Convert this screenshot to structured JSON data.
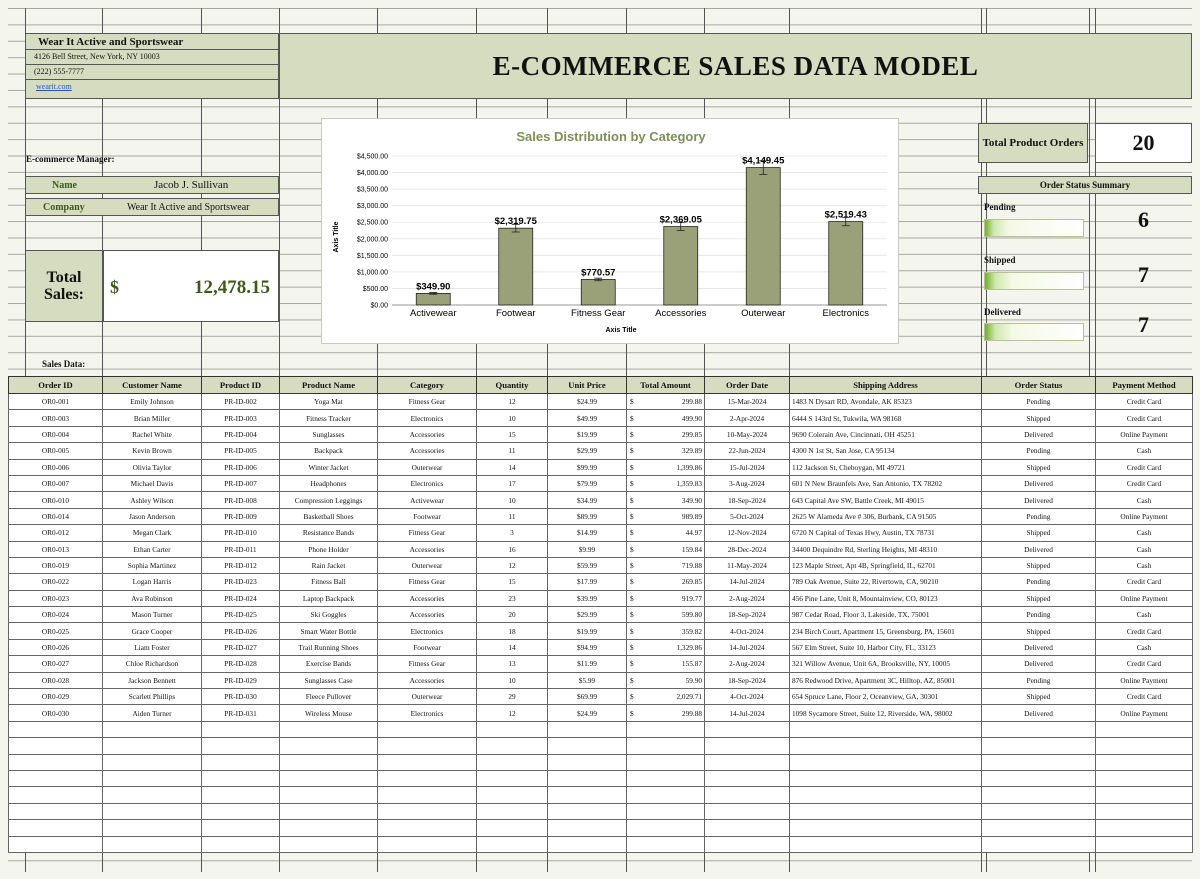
{
  "company": {
    "name": "Wear It Active and Sportswear",
    "address": "4126 Bell Street, New York, NY 10003",
    "phone": "(222) 555-7777",
    "website": "wearit.com"
  },
  "page_title": "E-COMMERCE SALES DATA MODEL",
  "manager": {
    "section_label": "E-commerce Manager:",
    "name_label": "Name",
    "name_value": "Jacob J. Sullivan",
    "company_label": "Company",
    "company_value": "Wear It Active and Sportswear"
  },
  "total_sales": {
    "label": "Total Sales:",
    "currency": "$",
    "value": "12,478.15"
  },
  "summary": {
    "total_orders_label": "Total Product Orders",
    "total_orders_value": "20",
    "status_title": "Order Status Summary",
    "statuses": [
      {
        "label": "Pending",
        "count": "6",
        "fill": 0.3
      },
      {
        "label": "Shipped",
        "count": "7",
        "fill": 0.35
      },
      {
        "label": "Delivered",
        "count": "7",
        "fill": 0.35
      }
    ]
  },
  "sales_data_label": "Sales Data:",
  "table": {
    "headers": [
      "Order ID",
      "Customer Name",
      "Product ID",
      "Product Name",
      "Category",
      "Quantity",
      "Unit Price",
      "Total Amount",
      "Order Date",
      "Shipping Address",
      "Order Status",
      "Payment Method"
    ],
    "rows": [
      [
        "OR0-001",
        "Emily Johnson",
        "PR-ID-002",
        "Yoga Mat",
        "Fitness Gear",
        "12",
        "$24.99",
        "299.88",
        "15-Mar-2024",
        "1483 N Dysart RD, Avondale, AK 85323",
        "Pending",
        "Credit Card"
      ],
      [
        "OR0-003",
        "Brian Miller",
        "PR-ID-003",
        "Fitness Tracker",
        "Electronics",
        "10",
        "$49.99",
        "499.90",
        "2-Apr-2024",
        "6444 S 143rd St, Tukwila, WA 98168",
        "Shipped",
        "Credit Card"
      ],
      [
        "OR0-004",
        "Rachel White",
        "PR-ID-004",
        "Sunglasses",
        "Accessories",
        "15",
        "$19.99",
        "299.85",
        "10-May-2024",
        "9690 Colerain Ave, Cincinnati, OH 45251",
        "Delivered",
        "Online Payment"
      ],
      [
        "OR0-005",
        "Kevin Brown",
        "PR-ID-005",
        "Backpack",
        "Accessories",
        "11",
        "$29.99",
        "329.89",
        "22-Jun-2024",
        "4300 N 1st St, San Jose, CA 95134",
        "Pending",
        "Cash"
      ],
      [
        "OR0-006",
        "Olivia Taylor",
        "PR-ID-006",
        "Winter Jacket",
        "Outerwear",
        "14",
        "$99.99",
        "1,399.86",
        "15-Jul-2024",
        "112 Jackson St, Cheboygan, MI 49721",
        "Shipped",
        "Credit Card"
      ],
      [
        "OR0-007",
        "Michael Davis",
        "PR-ID-007",
        "Headphones",
        "Electronics",
        "17",
        "$79.99",
        "1,359.83",
        "3-Aug-2024",
        "601 N New Braunfels Ave, San Antonio, TX 78202",
        "Delivered",
        "Credit Card"
      ],
      [
        "OR0-010",
        "Ashley Wilson",
        "PR-ID-008",
        "Compression Leggings",
        "Activewear",
        "10",
        "$34.99",
        "349.90",
        "18-Sep-2024",
        "643 Capital Ave SW, Battle Creek, MI 49015",
        "Delivered",
        "Cash"
      ],
      [
        "OR0-014",
        "Jason Anderson",
        "PR-ID-009",
        "Basketball Shoes",
        "Footwear",
        "11",
        "$89.99",
        "989.89",
        "5-Oct-2024",
        "2625 W Alameda Ave # 306, Burbank, CA 91505",
        "Pending",
        "Online Payment"
      ],
      [
        "OR0-012",
        "Megan Clark",
        "PR-ID-010",
        "Resistance Bands",
        "Fitness Gear",
        "3",
        "$14.99",
        "44.97",
        "12-Nov-2024",
        "6720 N Capital of Texas Hwy, Austin, TX 78731",
        "Shipped",
        "Cash"
      ],
      [
        "OR0-013",
        "Ethan Carter",
        "PR-ID-011",
        "Phone Holder",
        "Accessories",
        "16",
        "$9.99",
        "159.84",
        "28-Dec-2024",
        "34400 Dequindre Rd, Sterling Heights, MI 48310",
        "Delivered",
        "Cash"
      ],
      [
        "OR0-019",
        "Sophia Martinez",
        "PR-ID-012",
        "Rain Jacket",
        "Outerwear",
        "12",
        "$59.99",
        "719.88",
        "11-May-2024",
        "123 Maple Street, Apt 4B, Springfield, IL, 62701",
        "Shipped",
        "Cash"
      ],
      [
        "OR0-022",
        "Logan Harris",
        "PR-ID-023",
        "Fitness Ball",
        "Fitness Gear",
        "15",
        "$17.99",
        "269.85",
        "14-Jul-2024",
        "789 Oak Avenue, Suite 22, Rivertown, CA, 90210",
        "Pending",
        "Credit Card"
      ],
      [
        "OR0-023",
        "Ava Robinson",
        "PR-ID-024",
        "Laptop Backpack",
        "Accessories",
        "23",
        "$39.99",
        "919.77",
        "2-Aug-2024",
        "456 Pine Lane, Unit 8, Mountainview, CO, 80123",
        "Shipped",
        "Online Payment"
      ],
      [
        "OR0-024",
        "Mason Turner",
        "PR-ID-025",
        "Ski Goggles",
        "Accessories",
        "20",
        "$29.99",
        "599.80",
        "18-Sep-2024",
        "987 Cedar Road, Floor 3, Lakeside, TX, 75001",
        "Pending",
        "Cash"
      ],
      [
        "OR0-025",
        "Grace Cooper",
        "PR-ID-026",
        "Smart Water Bottle",
        "Electronics",
        "18",
        "$19.99",
        "359.82",
        "4-Oct-2024",
        "234 Birch Court, Apartment 15, Greensburg, PA, 15601",
        "Shipped",
        "Credit Card"
      ],
      [
        "OR0-026",
        "Liam Foster",
        "PR-ID-027",
        "Trail Running Shoes",
        "Footwear",
        "14",
        "$94.99",
        "1,329.86",
        "14-Jul-2024",
        "567 Elm Street, Suite 10, Harbor City, FL, 33123",
        "Delivered",
        "Cash"
      ],
      [
        "OR0-027",
        "Chloe Richardson",
        "PR-ID-028",
        "Exercise Bands",
        "Fitness Gear",
        "13",
        "$11.99",
        "155.87",
        "2-Aug-2024",
        "321 Willow Avenue, Unit 6A, Brooksville, NY, 10005",
        "Delivered",
        "Credit Card"
      ],
      [
        "OR0-028",
        "Jackson Bennett",
        "PR-ID-029",
        "Sunglasses Case",
        "Accessories",
        "10",
        "$5.99",
        "59.90",
        "18-Sep-2024",
        "876 Redwood Drive, Apartment 3C, Hilltop, AZ, 85001",
        "Pending",
        "Online Payment"
      ],
      [
        "OR0-029",
        "Scarlett Phillips",
        "PR-ID-030",
        "Fleece Pullover",
        "Outerwear",
        "29",
        "$69.99",
        "2,029.71",
        "4-Oct-2024",
        "654 Spruce Lane, Floor 2, Oceanview, GA, 30301",
        "Shipped",
        "Credit Card"
      ],
      [
        "OR0-030",
        "Aiden Turner",
        "PR-ID-031",
        "Wireless Mouse",
        "Electronics",
        "12",
        "$24.99",
        "299.88",
        "14-Jul-2024",
        "1098 Sycamore Street, Suite 12, Riverside, WA, 98002",
        "Delivered",
        "Online Payment"
      ]
    ],
    "currency_symbol": "$"
  },
  "chart_data": {
    "type": "bar",
    "title": "Sales Distribution by Category",
    "xlabel": "Axis Title",
    "ylabel": "Axis Title",
    "categories": [
      "Activewear",
      "Footwear",
      "Fitness Gear",
      "Accessories",
      "Outerwear",
      "Electronics"
    ],
    "values": [
      349.9,
      2319.75,
      770.57,
      2369.05,
      4149.45,
      2519.43
    ],
    "value_labels": [
      "$349.90",
      "$2,319.75",
      "$770.57",
      "$2,369.05",
      "$4,149.45",
      "$2,519.43"
    ],
    "ylim": [
      0,
      4500
    ],
    "y_ticks": [
      "$0.00",
      "$500.00",
      "$1,000.00",
      "$1,500.00",
      "$2,000.00",
      "$2,500.00",
      "$3,000.00",
      "$3,500.00",
      "$4,000.00",
      "$4,500.00"
    ],
    "grid": true,
    "error_bars": true,
    "colors": {
      "bar": "#9aa077",
      "title": "#7f8f56",
      "bar_stroke": "#222222"
    }
  }
}
